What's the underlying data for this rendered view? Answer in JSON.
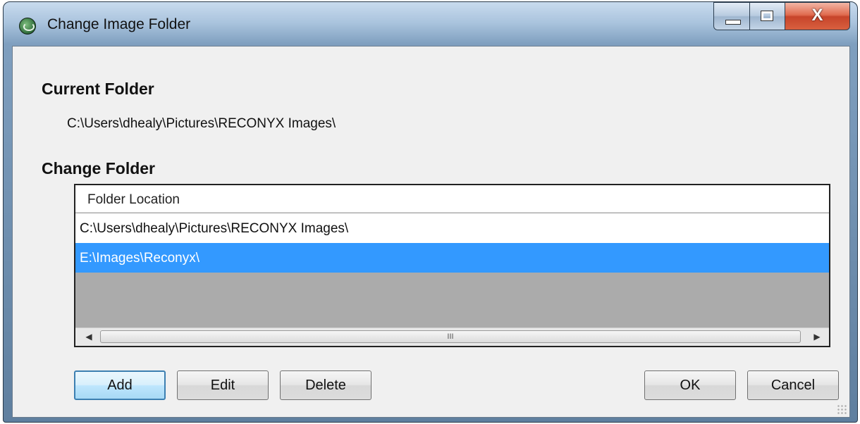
{
  "window": {
    "title": "Change Image Folder",
    "buttons": {
      "minimize": "minimize-icon",
      "maximize": "maximize-icon",
      "close": "X"
    }
  },
  "current_folder": {
    "heading": "Current Folder",
    "path": "C:\\Users\\dhealy\\Pictures\\RECONYX Images\\"
  },
  "change_folder": {
    "heading": "Change Folder",
    "column_header": "Folder Location",
    "rows": [
      {
        "path": "C:\\Users\\dhealy\\Pictures\\RECONYX Images\\",
        "selected": false
      },
      {
        "path": "E:\\Images\\Reconyx\\",
        "selected": true
      }
    ],
    "scrollbar": {
      "left": "◀",
      "right": "▶",
      "grip": "III"
    }
  },
  "buttons": {
    "add": "Add",
    "edit": "Edit",
    "delete": "Delete",
    "ok": "OK",
    "cancel": "Cancel"
  },
  "colors": {
    "selection": "#3399ff",
    "list_background": "#ababab",
    "dialog_background": "#f0f0f0"
  }
}
